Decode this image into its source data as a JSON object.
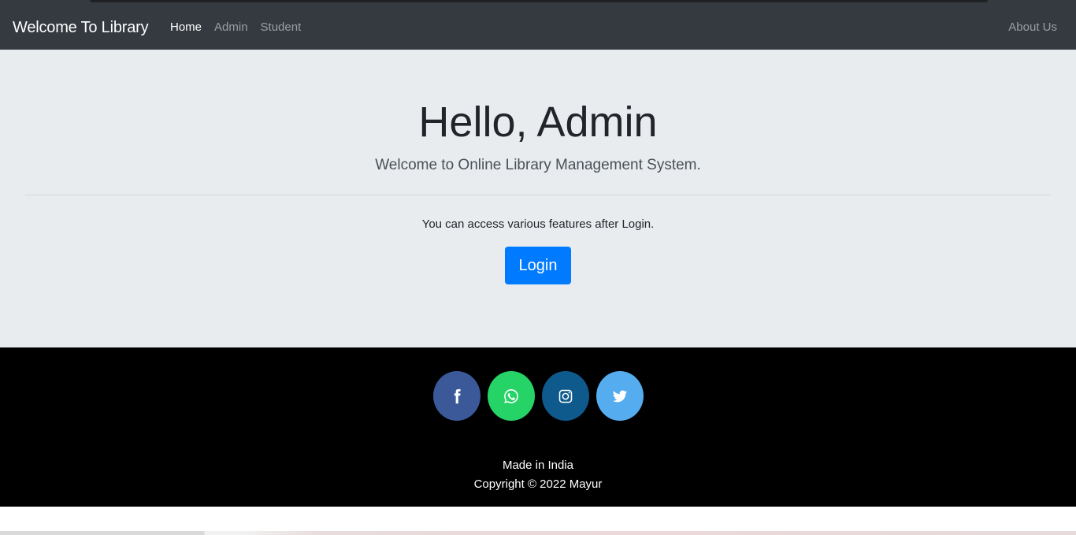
{
  "navbar": {
    "brand": "Welcome To Library",
    "links": [
      {
        "label": "Home",
        "active": true
      },
      {
        "label": "Admin",
        "active": false
      },
      {
        "label": "Student",
        "active": false
      }
    ],
    "right_link": "About Us"
  },
  "hero": {
    "title": "Hello, Admin",
    "lead": "Welcome to Online Library Management System.",
    "text": "You can access various features after Login.",
    "button_label": "Login"
  },
  "footer": {
    "social": [
      {
        "icon": "facebook-icon",
        "color": "#3b5998"
      },
      {
        "icon": "whatsapp-icon",
        "color": "#25d366"
      },
      {
        "icon": "instagram-icon",
        "color": "#0f5a8c"
      },
      {
        "icon": "twitter-icon",
        "color": "#55acee"
      }
    ],
    "made_in": "Made in India",
    "copyright": "Copyright © 2022 Mayur"
  },
  "colors": {
    "navbar_bg": "#343a40",
    "jumbotron_bg": "#e9ecef",
    "primary": "#007bff",
    "footer_bg": "#000000"
  }
}
